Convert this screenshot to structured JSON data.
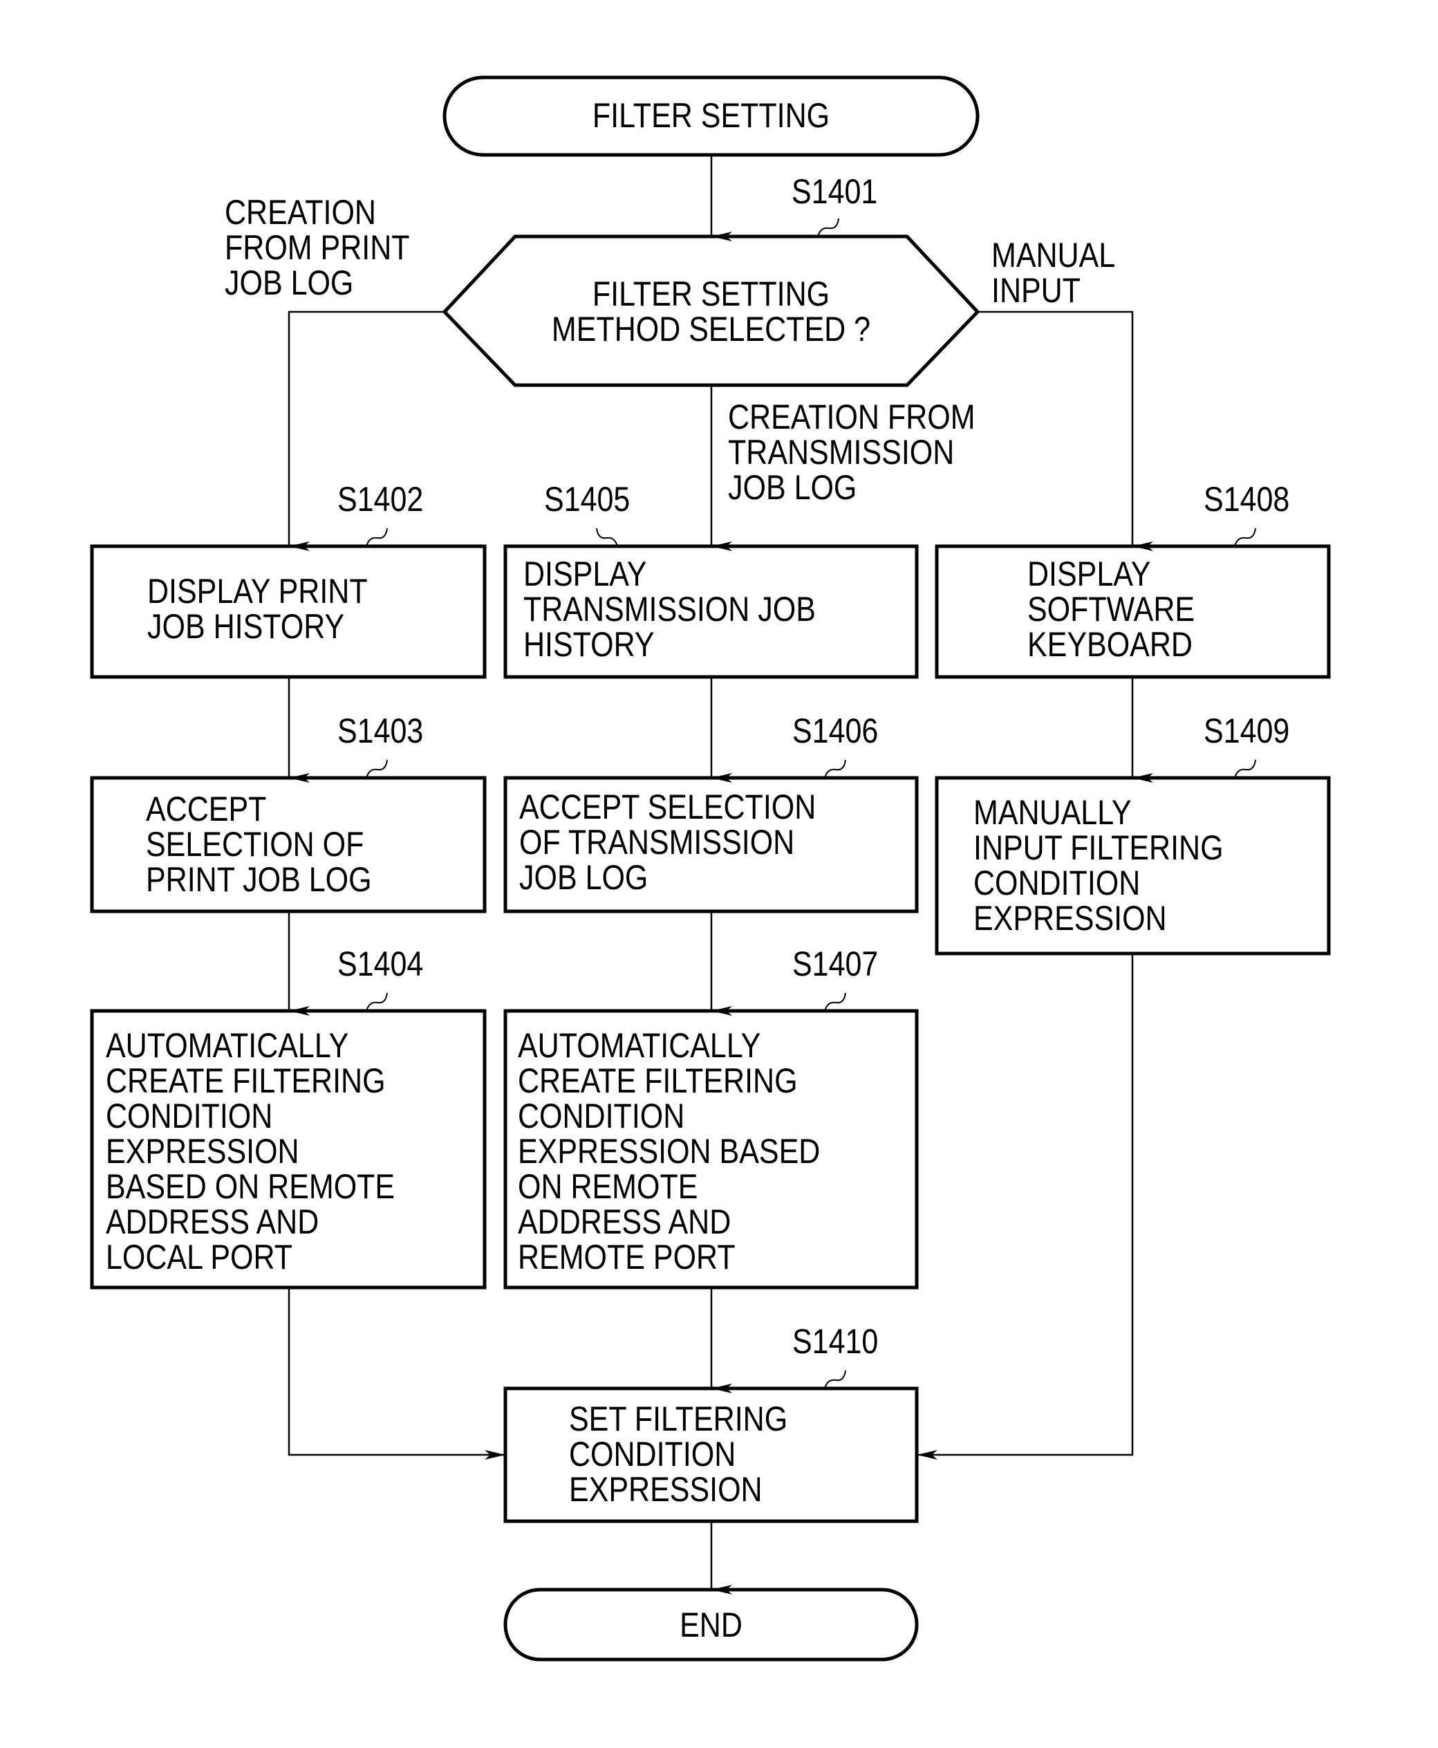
{
  "diagram": {
    "type": "flowchart",
    "start": {
      "label": "FILTER SETTING"
    },
    "decision": {
      "step": "S1401",
      "label": "FILTER SETTING\nMETHOD SELECTED ?",
      "branches": {
        "left": "CREATION\nFROM PRINT\nJOB LOG",
        "center": "CREATION FROM\nTRANSMISSION\nJOB LOG",
        "right": "MANUAL\nINPUT"
      }
    },
    "columns": {
      "print": [
        {
          "step": "S1402",
          "label": "DISPLAY PRINT\nJOB HISTORY"
        },
        {
          "step": "S1403",
          "label": "ACCEPT\nSELECTION OF\nPRINT JOB LOG"
        },
        {
          "step": "S1404",
          "label": "AUTOMATICALLY\nCREATE FILTERING\nCONDITION\nEXPRESSION\nBASED ON REMOTE\nADDRESS AND\nLOCAL PORT"
        }
      ],
      "transmission": [
        {
          "step": "S1405",
          "label": "DISPLAY\nTRANSMISSION JOB\nHISTORY"
        },
        {
          "step": "S1406",
          "label": "ACCEPT SELECTION\nOF TRANSMISSION\nJOB LOG"
        },
        {
          "step": "S1407",
          "label": "AUTOMATICALLY\nCREATE FILTERING\nCONDITION\nEXPRESSION BASED\nON REMOTE\nADDRESS AND\nREMOTE PORT"
        }
      ],
      "manual": [
        {
          "step": "S1408",
          "label": "DISPLAY\nSOFTWARE\nKEYBOARD"
        },
        {
          "step": "S1409",
          "label": "MANUALLY\nINPUT FILTERING\nCONDITION\nEXPRESSION"
        }
      ]
    },
    "merge": {
      "step": "S1410",
      "label": "SET FILTERING\nCONDITION\nEXPRESSION"
    },
    "end": {
      "label": "END"
    }
  }
}
